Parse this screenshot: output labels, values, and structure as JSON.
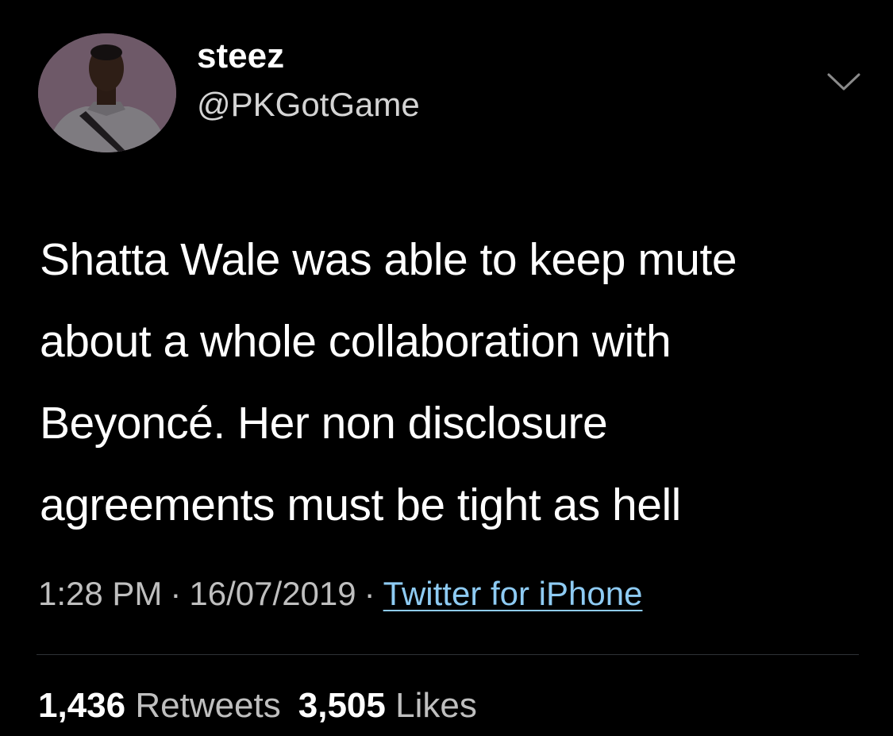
{
  "tweet": {
    "author": {
      "display_name": "steez",
      "handle": "@PKGotGame",
      "avatar_icon": "profile-photo"
    },
    "text": "Shatta Wale was able to keep mute\nabout a whole collaboration with\nBeyoncé. Her non disclosure\nagreements must be tight as hell",
    "time": "1:28 PM",
    "date": "16/07/2019",
    "separator": "·",
    "source": "Twitter for iPhone",
    "retweets_count": "1,436",
    "retweets_label": "Retweets",
    "likes_count": "3,505",
    "likes_label": "Likes",
    "menu_icon": "chevron-down-icon"
  },
  "colors": {
    "background": "#000000",
    "text": "#ffffff",
    "secondary_text": "#bfbfbf",
    "link": "#8ecbf3"
  }
}
